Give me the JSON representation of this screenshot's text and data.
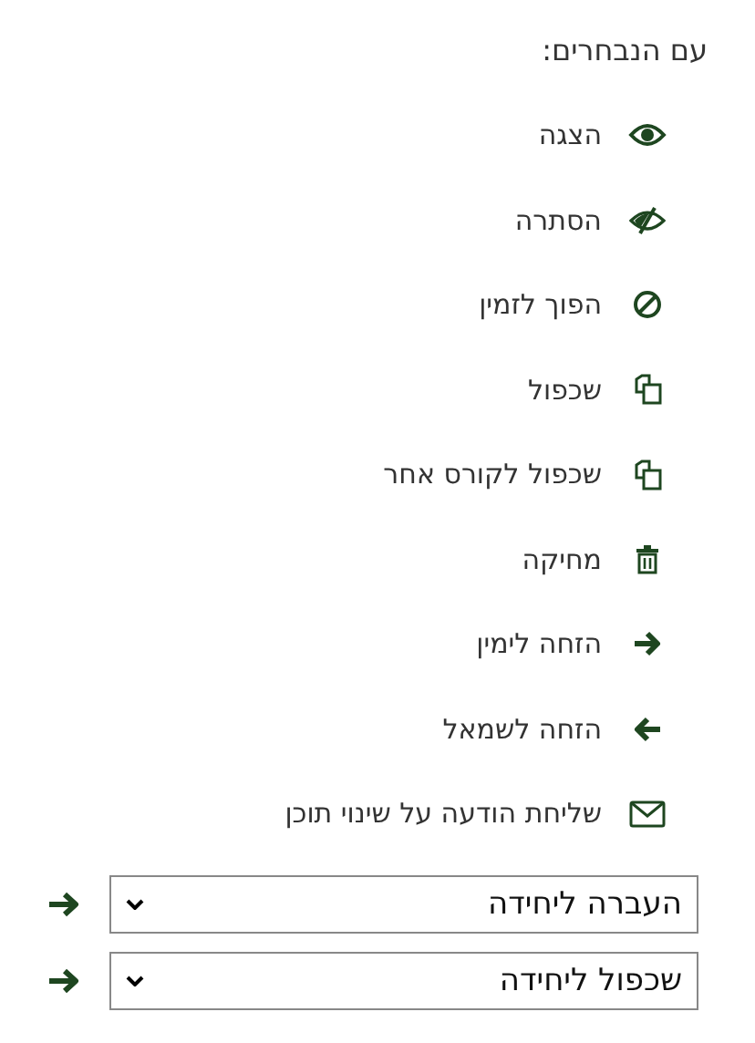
{
  "heading": "עם הנבחרים:",
  "actions": [
    {
      "kind": "show",
      "label": "הצגה"
    },
    {
      "kind": "hide",
      "label": "הסתרה"
    },
    {
      "kind": "unavailable",
      "label": "הפוך לזמין"
    },
    {
      "kind": "copy",
      "label": "שכפול"
    },
    {
      "kind": "copy",
      "label": "שכפול לקורס אחר"
    },
    {
      "kind": "delete",
      "label": "מחיקה"
    },
    {
      "kind": "right",
      "label": "הזחה לימין"
    },
    {
      "kind": "left",
      "label": "הזחה לשמאל"
    },
    {
      "kind": "mail",
      "label": "שליחת הודעה על שינוי תוכן"
    }
  ],
  "selects": [
    {
      "value": "העברה ליחידה"
    },
    {
      "value": "שכפול ליחידה"
    }
  ]
}
